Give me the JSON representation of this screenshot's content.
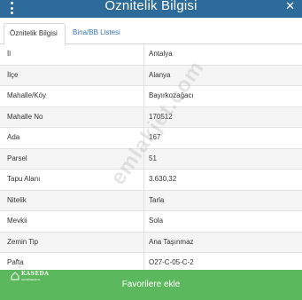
{
  "header": {
    "title": "Öznitelik Bilgisi",
    "menu_icon": "more-vertical-icon",
    "close_icon": "close-icon",
    "close_glyph": "✕"
  },
  "tabs": [
    {
      "label": "Öznitelik Bilgisi",
      "active": true
    },
    {
      "label": "Bina/BB Listesi",
      "active": false
    }
  ],
  "rows": [
    {
      "label": "İl",
      "value": "Antalya"
    },
    {
      "label": "İlçe",
      "value": "Alanya"
    },
    {
      "label": "Mahalle/Köy",
      "value": "Bayırkozağacı"
    },
    {
      "label": "Mahalle No",
      "value": "170512"
    },
    {
      "label": "Ada",
      "value": "167"
    },
    {
      "label": "Parsel",
      "value": "51"
    },
    {
      "label": "Tapu Alanı",
      "value": "3.630,32"
    },
    {
      "label": "Nitelik",
      "value": "Tarla"
    },
    {
      "label": "Mevkii",
      "value": "Sola"
    },
    {
      "label": "Zemin Tip",
      "value": "Ana Taşınmaz"
    },
    {
      "label": "Pafta",
      "value": "O27-C-05-C-2"
    }
  ],
  "watermark": "emlakjet.com",
  "footer": {
    "button_label": "Favorilere ekle",
    "logo_text": "KASEDA",
    "logo_sub": "GAYRİMENKUL"
  },
  "colors": {
    "header_bg": "#2d6b9a",
    "tab_link": "#3a76b5",
    "button_bg": "#5cb85c"
  }
}
